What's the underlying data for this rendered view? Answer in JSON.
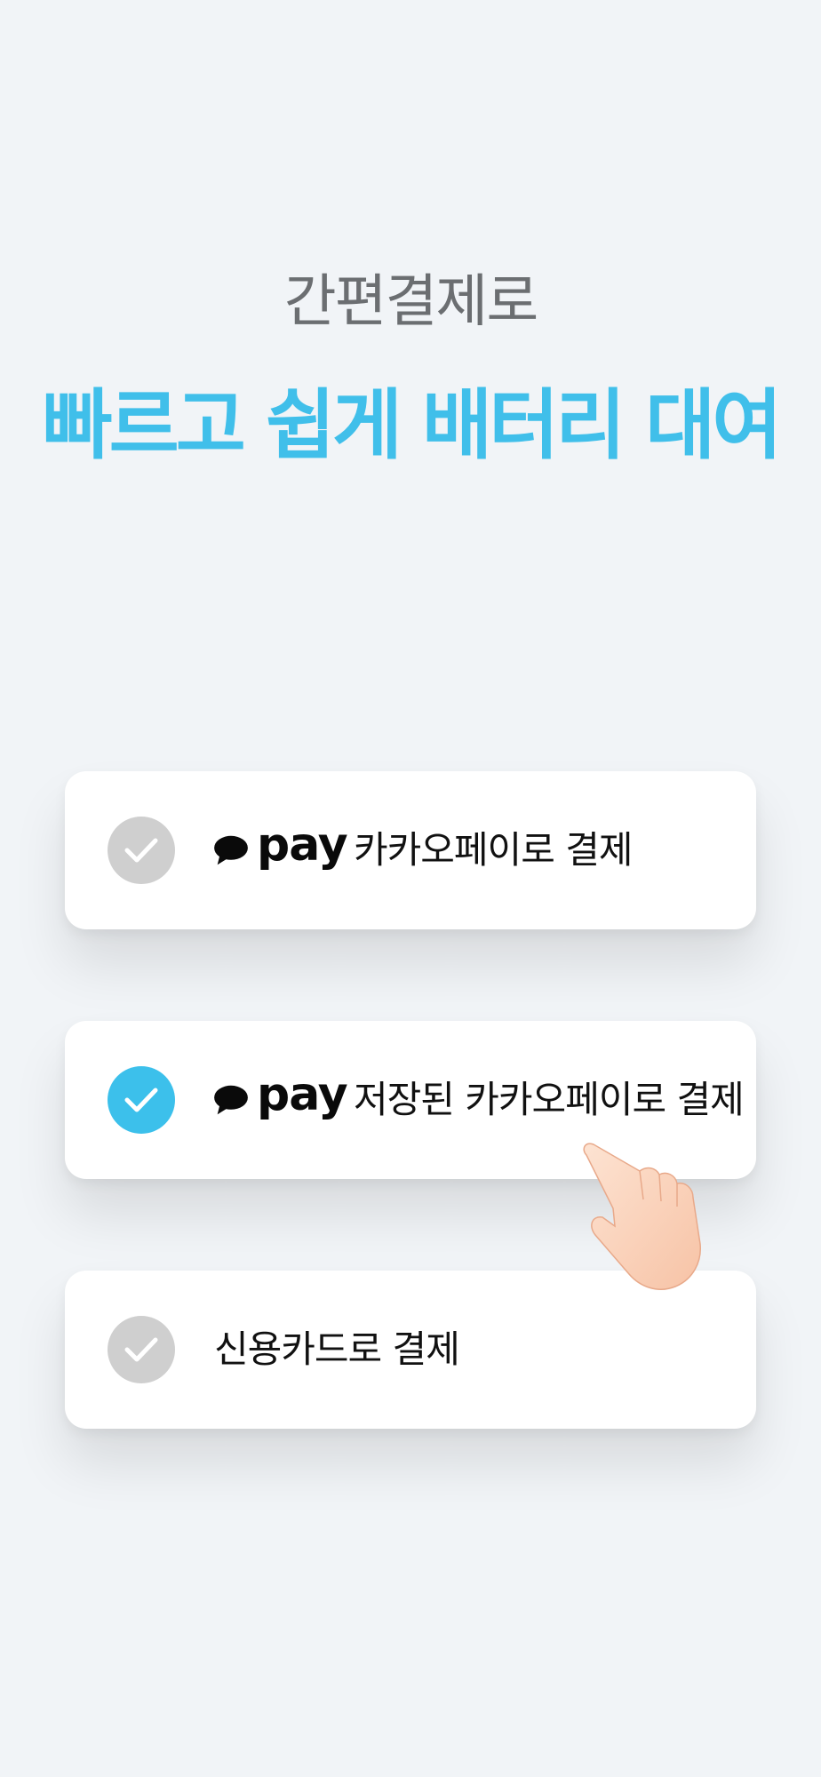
{
  "header": {
    "subtitle": "간편결제로",
    "title": "빠르고 쉽게 배터리 대여"
  },
  "payment_options": [
    {
      "logo_text": "pay",
      "label": "카카오페이로 결제",
      "selected": false,
      "has_logo": true
    },
    {
      "logo_text": "pay",
      "label": "저장된 카카오페이로 결제",
      "selected": true,
      "has_logo": true
    },
    {
      "logo_text": "",
      "label": "신용카드로 결제",
      "selected": false,
      "has_logo": false
    }
  ],
  "colors": {
    "accent": "#40bfea",
    "check_active": "#3cc0eb",
    "check_inactive": "#cfcfcf",
    "subtitle": "#6b6e71",
    "background": "#f1f4f7"
  },
  "icons": {
    "check": "check-icon",
    "kakao_bubble": "kakao-speech-bubble-icon",
    "hand": "pointing-hand-icon"
  }
}
